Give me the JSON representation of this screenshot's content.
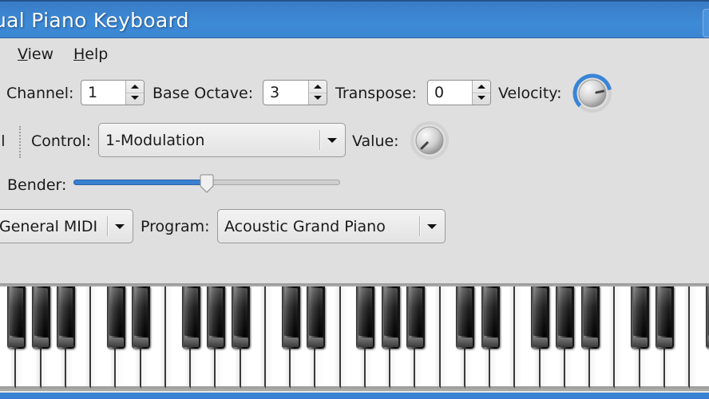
{
  "window": {
    "title": "Virtual Piano Keyboard",
    "title_visible": "ual Piano Keyboard"
  },
  "menubar": {
    "items": [
      {
        "label": "View",
        "mnemonic": "V",
        "rest": "iew"
      },
      {
        "label": "Help",
        "mnemonic": "H",
        "rest": "elp"
      }
    ]
  },
  "toolbar1": {
    "channel_label": "Channel:",
    "channel_value": "1",
    "base_octave_label": "Base Octave:",
    "base_octave_value": "3",
    "transpose_label": "Transpose:",
    "transpose_value": "0",
    "velocity_label": "Velocity:",
    "velocity_level": 0.79
  },
  "toolbar2": {
    "clipped_left_text": "ll",
    "control_label": "Control:",
    "control_value": "1-Modulation",
    "value_label": "Value:",
    "value_level": 0.0
  },
  "toolbar3": {
    "bender_label": "Bender:",
    "bender_position": 0.5
  },
  "toolbar4": {
    "bank_value": "General MIDI",
    "program_label": "Program:",
    "program_value": "Acoustic Grand Piano"
  },
  "keyboard": {
    "white_key_count": 29,
    "pattern_note": "black keys grouped 3-2-3-2-3-2-3-2-1 across visible range"
  },
  "colors": {
    "titlebar": "#3d8ad6",
    "accent": "#3a7fd0",
    "background": "#dfdfdf"
  }
}
